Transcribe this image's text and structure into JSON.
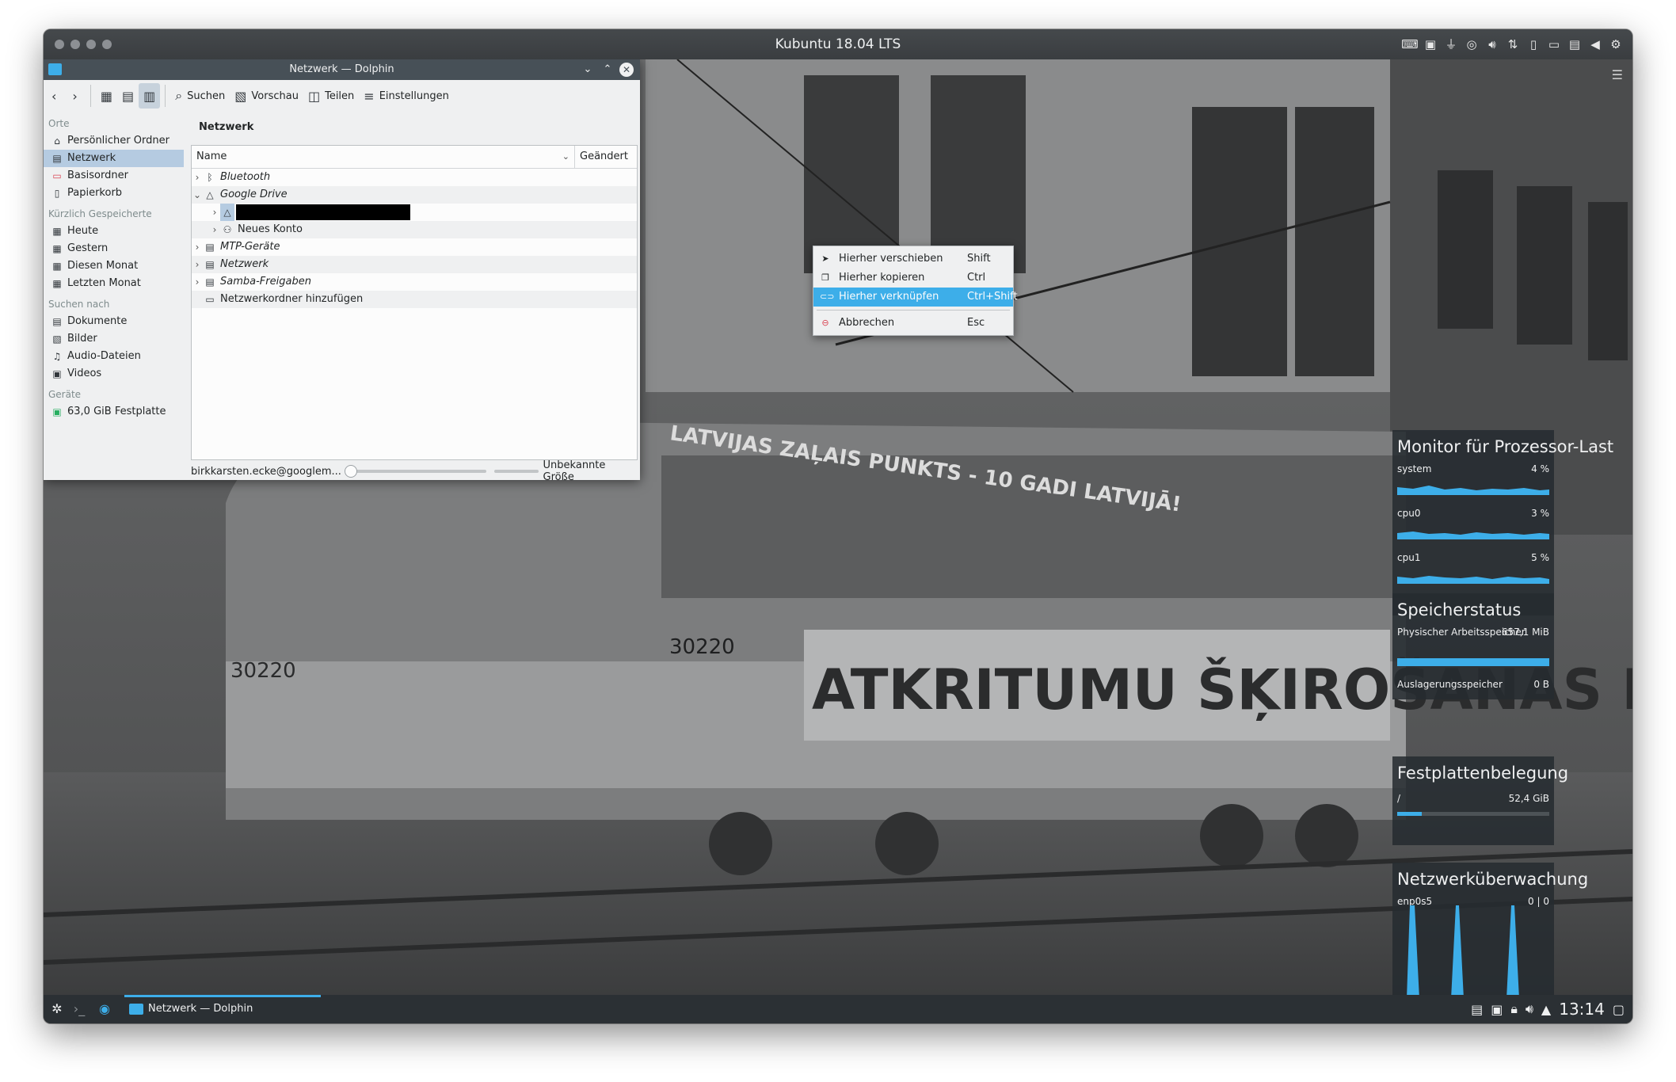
{
  "vm": {
    "title": "Kubuntu 18.04 LTS",
    "tray_icons": [
      "keyboard-icon",
      "chip-icon",
      "usb-icon",
      "cd-icon",
      "audio-icon",
      "network-icon",
      "display-icon",
      "camera-icon",
      "folder-icon",
      "arrow-icon",
      "gear-icon"
    ]
  },
  "dolphin": {
    "title": "Netzwerk — Dolphin",
    "toolbar": {
      "search": "Suchen",
      "preview": "Vorschau",
      "split": "Teilen",
      "settings": "Einstellungen"
    },
    "location": "Netzwerk",
    "places": {
      "orte_header": "Orte",
      "orte": [
        {
          "label": "Persönlicher Ordner",
          "icon": "home-icon"
        },
        {
          "label": "Netzwerk",
          "icon": "network-icon",
          "selected": true
        },
        {
          "label": "Basisordner",
          "icon": "drive-icon"
        },
        {
          "label": "Papierkorb",
          "icon": "trash-icon"
        }
      ],
      "recent_header": "Kürzlich Gespeicherte",
      "recent": [
        "Heute",
        "Gestern",
        "Diesen Monat",
        "Letzten Monat"
      ],
      "search_header": "Suchen nach",
      "search": [
        "Dokumente",
        "Bilder",
        "Audio-Dateien",
        "Videos"
      ],
      "devices_header": "Geräte",
      "devices": [
        "63,0 GiB Festplatte"
      ]
    },
    "columns": {
      "name": "Name",
      "modified": "Geändert"
    },
    "rows": {
      "bluetooth": "Bluetooth",
      "google_drive": "Google Drive",
      "new_account": "Neues Konto",
      "mtp": "MTP-Geräte",
      "network": "Netzwerk",
      "samba": "Samba-Freigaben",
      "add_folder": "Netzwerkordner hinzufügen"
    },
    "status": {
      "left": "birkkarsten.ecke@googlem...",
      "right": "Unbekannte Größe"
    }
  },
  "context_menu": [
    {
      "label": "Hierher verschieben",
      "key": "Shift",
      "icon": "move-icon"
    },
    {
      "label": "Hierher kopieren",
      "key": "Ctrl",
      "icon": "copy-icon"
    },
    {
      "label": "Hierher verknüpfen",
      "key": "Ctrl+Shift",
      "icon": "link-icon",
      "highlighted": true
    },
    {
      "label": "Abbrechen",
      "key": "Esc",
      "icon": "cancel-icon"
    }
  ],
  "widgets": {
    "cpu": {
      "title": "Monitor für Prozessor-Last",
      "rows": [
        {
          "label": "system",
          "value": "4 %"
        },
        {
          "label": "cpu0",
          "value": "3 %"
        },
        {
          "label": "cpu1",
          "value": "5 %"
        }
      ]
    },
    "memory": {
      "title": "Speicherstatus",
      "physical_label": "Physischer Arbeitsspeicher",
      "physical_value": "657,1 MiB",
      "swap_label": "Auslagerungsspeicher",
      "swap_value": "0 B"
    },
    "disk": {
      "title": "Festplattenbelegung",
      "mount": "/",
      "value": "52,4 GiB",
      "fill_fraction": 0.16
    },
    "network": {
      "title": "Netzwerküberwachung",
      "iface": "enp0s5",
      "value": "0 | 0"
    }
  },
  "taskbar": {
    "task_label": "Netzwerk — Dolphin",
    "clock": "13:14"
  }
}
